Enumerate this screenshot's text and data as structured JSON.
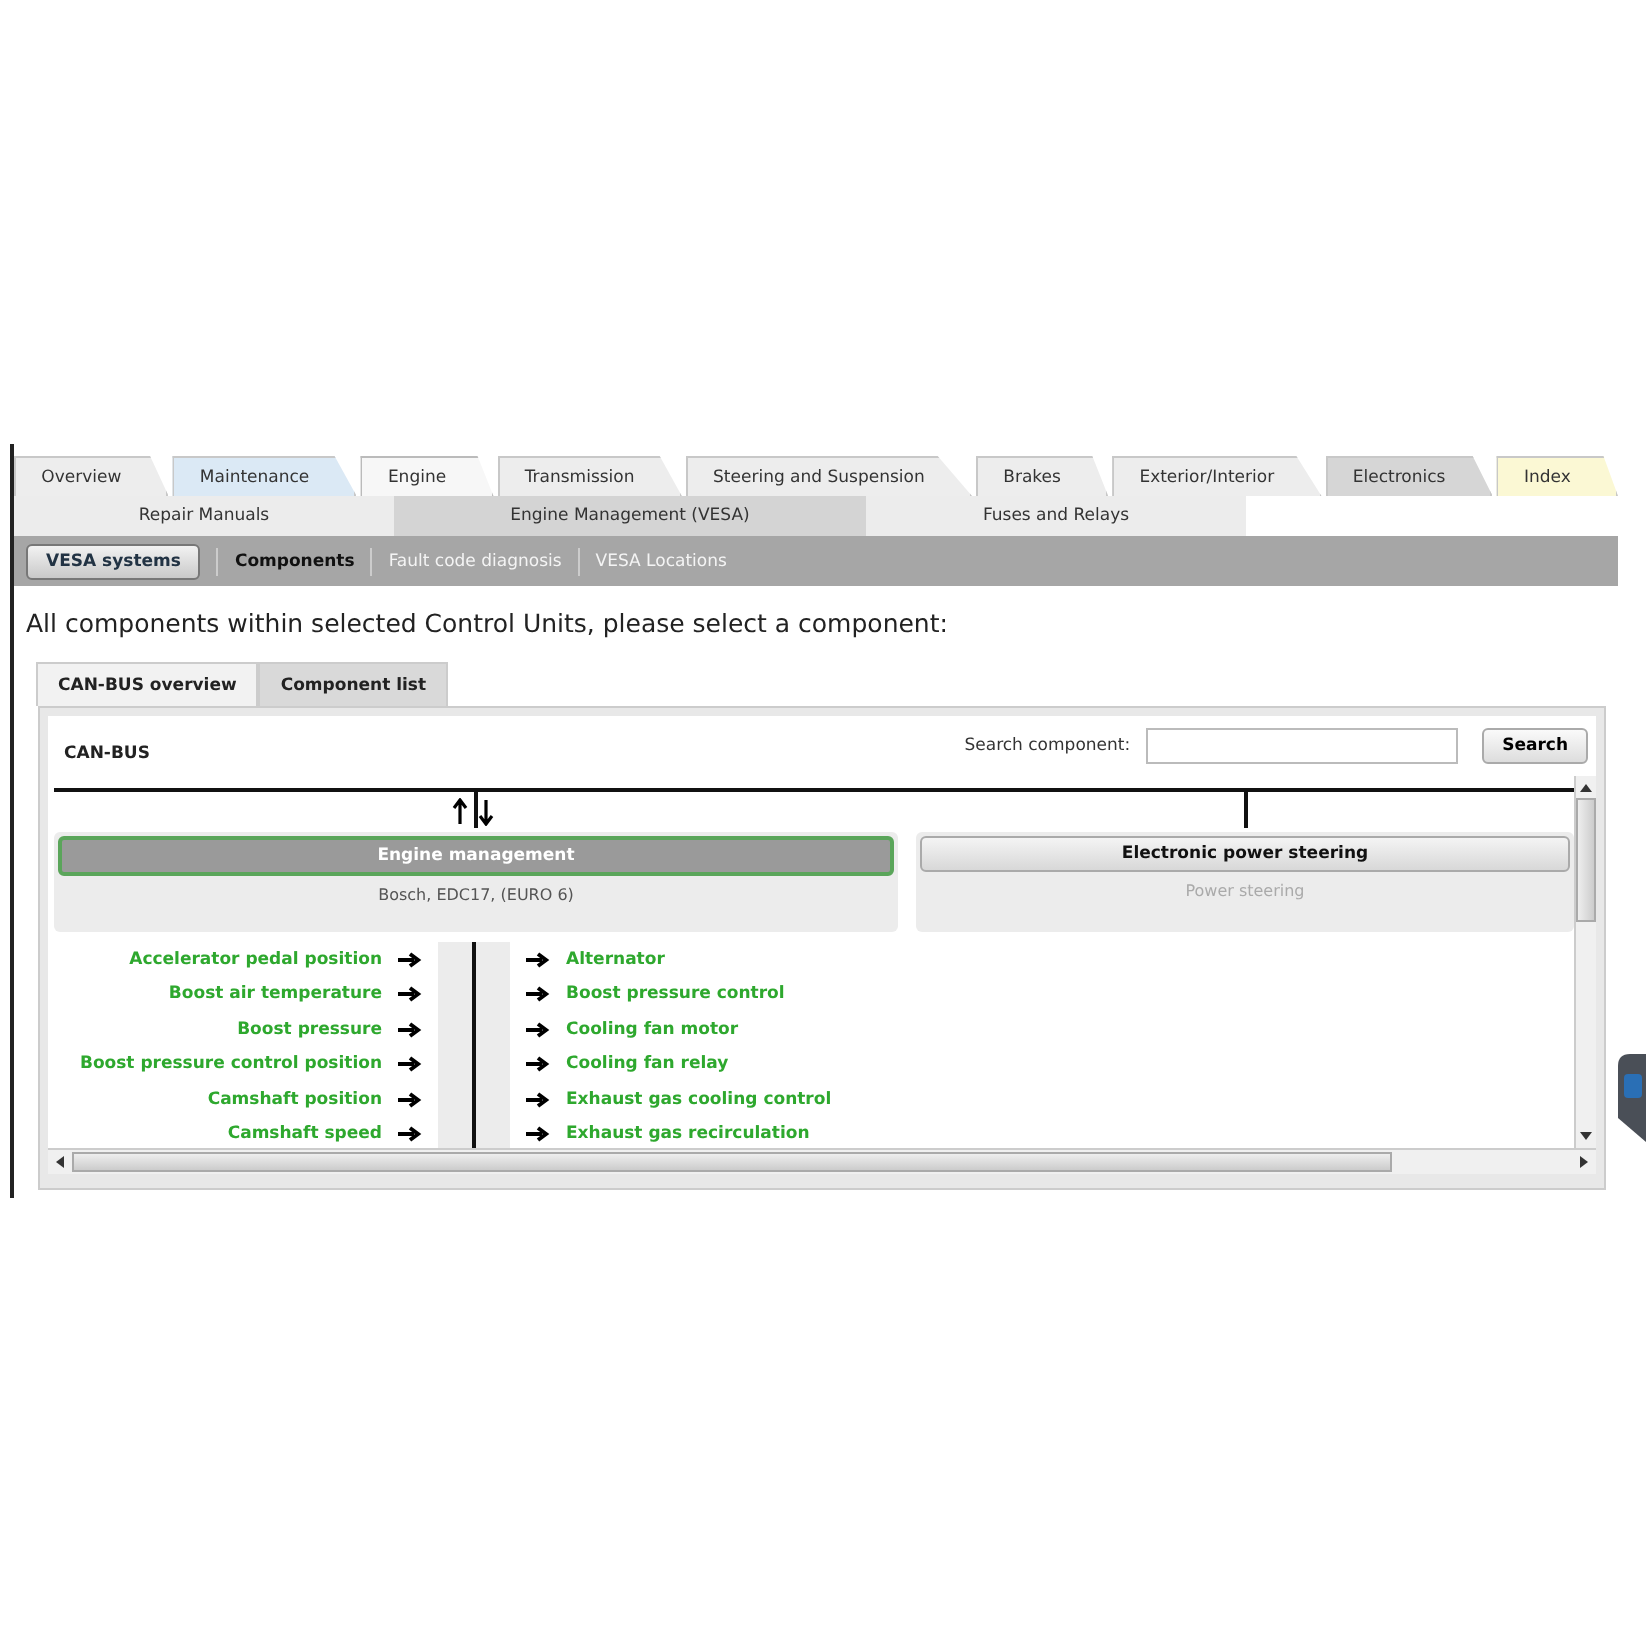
{
  "main_tabs": [
    {
      "label": "Overview",
      "selected": false,
      "color": "#ededed"
    },
    {
      "label": "Maintenance",
      "selected": false,
      "color": "#dbe9f5"
    },
    {
      "label": "Engine",
      "selected": true,
      "color": "#f7f7f7"
    },
    {
      "label": "Transmission",
      "selected": false,
      "color": "#ededed"
    },
    {
      "label": "Steering and Suspension",
      "selected": false,
      "color": "#ededed"
    },
    {
      "label": "Brakes",
      "selected": false,
      "color": "#ededed"
    },
    {
      "label": "Exterior/Interior",
      "selected": false,
      "color": "#ededed"
    },
    {
      "label": "Electronics",
      "selected": false,
      "color": "#d6d6d6"
    },
    {
      "label": "Index",
      "selected": false,
      "color": "#fbf8d4"
    }
  ],
  "sub_tabs": [
    {
      "label": "Repair Manuals",
      "selected": false
    },
    {
      "label": "Engine Management (VESA)",
      "selected": true
    },
    {
      "label": "Fuses and Relays",
      "selected": false
    }
  ],
  "toolbar": {
    "button": "VESA systems",
    "links": [
      {
        "label": "Components",
        "selected": true
      },
      {
        "label": "Fault code diagnosis",
        "selected": false
      },
      {
        "label": "VESA Locations",
        "selected": false
      }
    ]
  },
  "heading": "All components within selected Control Units, please select a component:",
  "view_tabs": [
    {
      "label": "CAN-BUS overview",
      "selected": true
    },
    {
      "label": "Component list",
      "selected": false
    }
  ],
  "panel": {
    "title": "CAN-BUS",
    "search_label": "Search component:",
    "search_button": "Search",
    "control_units": [
      {
        "name": "Engine management",
        "detail": "Bosch, EDC17, (EURO 6)",
        "selected": true
      },
      {
        "name": "Electronic power steering",
        "detail": "Power steering",
        "selected": false
      }
    ],
    "inputs": [
      "Accelerator pedal position",
      "Boost air temperature",
      "Boost pressure",
      "Boost pressure control position",
      "Camshaft position",
      "Camshaft speed"
    ],
    "outputs": [
      "Alternator",
      "Boost pressure control",
      "Cooling fan motor",
      "Cooling fan relay",
      "Exhaust gas cooling control",
      "Exhaust gas recirculation"
    ]
  }
}
